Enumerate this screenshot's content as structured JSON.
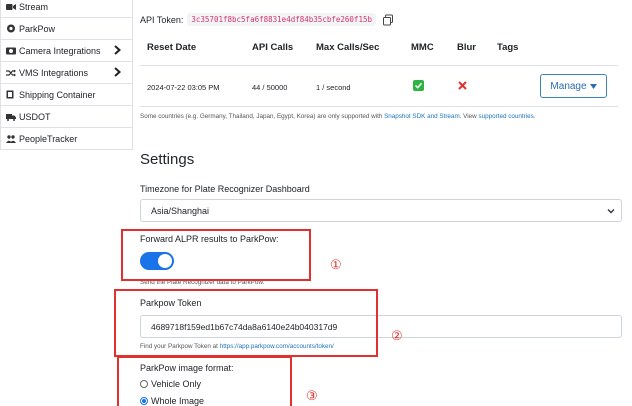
{
  "sidebar": {
    "items": [
      {
        "label": "Stream",
        "icon": "video-camera-icon",
        "has_chevron": false
      },
      {
        "label": "ParkPow",
        "icon": "parkpow-logo-icon",
        "has_chevron": false
      },
      {
        "label": "Camera Integrations",
        "icon": "camera-icon",
        "has_chevron": true
      },
      {
        "label": "VMS Integrations",
        "icon": "shuffle-icon",
        "has_chevron": true
      },
      {
        "label": "Shipping Container",
        "icon": "container-icon",
        "has_chevron": false
      },
      {
        "label": "USDOT",
        "icon": "truck-icon",
        "has_chevron": false
      },
      {
        "label": "PeopleTracker",
        "icon": "people-icon",
        "has_chevron": false
      }
    ]
  },
  "api": {
    "token_label": "API Token:",
    "token_value": "3c35701f8bc5fa6f8831e4df84b35cbfe260f15b"
  },
  "table": {
    "headers": [
      "Reset Date",
      "API Calls",
      "Max Calls/Sec",
      "MMC",
      "Blur",
      "Tags"
    ],
    "row": {
      "reset_date": "2024-07-22 03:05 PM",
      "api_calls": "44 / 50000",
      "max_calls_sec": "1 / second",
      "mmc": "enabled",
      "blur": "disabled",
      "tags": "",
      "manage_label": "Manage"
    }
  },
  "countries_note": {
    "prefix": "Some countries (e.g. Germany, Thailand, Japan, Egypt, Korea) are only supported with ",
    "link1": "Snapshot SDK and Stream",
    "middle": ". View ",
    "link2": "supported countries",
    "suffix": "."
  },
  "settings": {
    "title": "Settings",
    "timezone_label": "Timezone for Plate Recognizer Dashboard",
    "timezone_value": "Asia/Shanghai",
    "forward_label": "Forward ALPR results to ParkPow:",
    "forward_enabled": true,
    "forward_help": "Send the Plate Recognizer data to ParkPow.",
    "token_label": "Parkpow Token",
    "token_value": "4689718f159ed1b67c74da8a6140e24b040317d9",
    "token_help_prefix": "Find your Parkpow Token at ",
    "token_help_link": "https://app.parkpow.com/accounts/token/",
    "image_format_label": "ParkPow image format:",
    "image_format_options": [
      {
        "label": "Vehicle Only",
        "selected": false
      },
      {
        "label": "Whole Image",
        "selected": true
      }
    ]
  },
  "annotations": [
    "①",
    "②",
    "③"
  ],
  "colors": {
    "accent": "#1a73e8",
    "link": "#1e73be",
    "token_code": "#d6336c",
    "annotation": "#e0312f",
    "check": "#2fb344",
    "cross": "#e03131"
  }
}
